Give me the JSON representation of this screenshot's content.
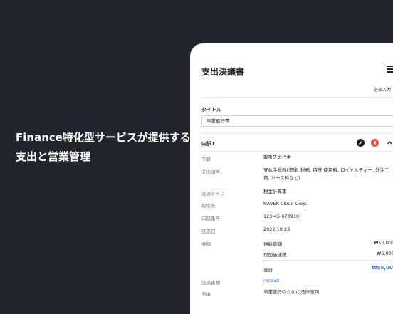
{
  "promo": {
    "line1": "Finance特化型サービスが提供する",
    "line2": "支出と営業管理"
  },
  "screen": {
    "title": "支出決議書",
    "required_note": "必須入力",
    "required_mark": "*",
    "title_field": {
      "label": "タイトル",
      "value": "事業進行費"
    },
    "section": {
      "title": "内訳1"
    },
    "rows": [
      {
        "key": "予算",
        "value": "取引先の代金"
      },
      {
        "key": "支出項目",
        "value": "支払手数料(法律, 税務, 特許 使用料, ロイヤルティー, 外注工賃, リース料など)"
      },
      {
        "key": "証憑タイプ",
        "value": "税金計算書"
      },
      {
        "key": "取引先",
        "value": "NAVER Cloud Corp."
      },
      {
        "key": "口座番号",
        "value": "123-45-678910"
      },
      {
        "key": "証憑日",
        "value": "2022.10.23"
      }
    ],
    "amount": {
      "key": "金額",
      "supply_label": "供給価額",
      "supply_value": "₩50,000",
      "tax_label": "付加価値税",
      "tax_value": "₩5,000",
      "total_label": "合計",
      "total_value": "₩55,000"
    },
    "docs": {
      "key": "証憑書類",
      "value": "receipt"
    },
    "reason": {
      "key": "事由",
      "value": "事業遂行のための法律諮問"
    }
  },
  "icons": {
    "edit": "pencil-icon",
    "delete": "trash-icon",
    "collapse": "chevron-up-icon",
    "menu": "hamburger-menu-icon"
  },
  "colors": {
    "background": "#23252e",
    "accent": "#2f6bdb",
    "delete": "#e8453c"
  }
}
